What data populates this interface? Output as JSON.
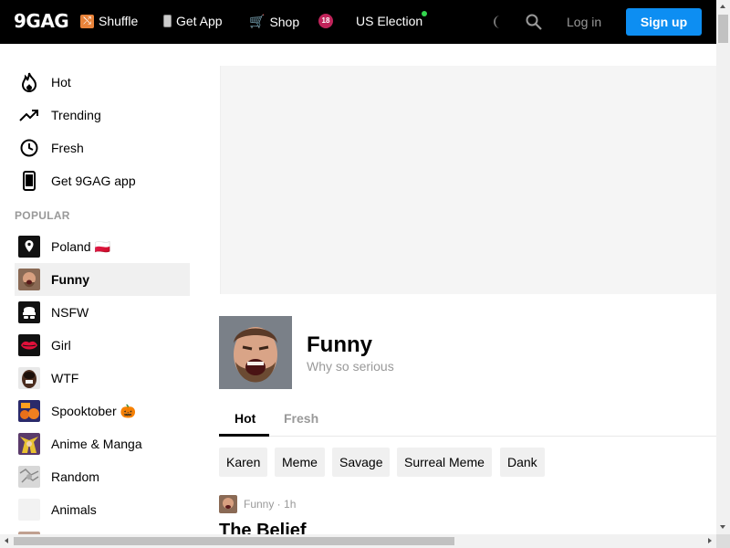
{
  "header": {
    "logo": "9GAG",
    "nav": [
      {
        "label": "Shuffle",
        "icon": "shuffle-icon"
      },
      {
        "label": "Get App",
        "icon": "phone-icon"
      },
      {
        "label": "Shop",
        "icon": "cart-icon"
      },
      {
        "label": "18",
        "icon": "nsfw-18-icon"
      },
      {
        "label": "US Election",
        "icon": "live-dot-icon"
      }
    ],
    "login_label": "Log in",
    "signup_label": "Sign up"
  },
  "sidebar": {
    "main_items": [
      {
        "label": "Hot",
        "icon": "fire-icon"
      },
      {
        "label": "Trending",
        "icon": "trending-icon"
      },
      {
        "label": "Fresh",
        "icon": "clock-icon"
      },
      {
        "label": "Get 9GAG app",
        "icon": "phone-icon"
      }
    ],
    "section_title": "POPULAR",
    "popular_items": [
      {
        "label": "Poland 🇵🇱",
        "icon": "location-icon"
      },
      {
        "label": "Funny",
        "icon": "funny-thumb",
        "active": true
      },
      {
        "label": "NSFW",
        "icon": "nsfw-icon"
      },
      {
        "label": "Girl",
        "icon": "lips-icon"
      },
      {
        "label": "WTF",
        "icon": "wtf-thumb"
      },
      {
        "label": "Spooktober 🎃",
        "icon": "spooktober-thumb"
      },
      {
        "label": "Anime & Manga",
        "icon": "anime-thumb"
      },
      {
        "label": "Random",
        "icon": "random-thumb"
      },
      {
        "label": "Animals",
        "icon": "animals-thumb"
      }
    ]
  },
  "section": {
    "title": "Funny",
    "description": "Why so serious",
    "tabs": [
      "Hot",
      "Fresh"
    ],
    "active_tab": "Hot",
    "tags": [
      "Karen",
      "Meme",
      "Savage",
      "Surreal Meme",
      "Dank"
    ]
  },
  "post": {
    "meta": "Funny · 1h",
    "title": "The Belief"
  },
  "colors": {
    "accent": "#0d8ef2",
    "header_bg": "#000000",
    "live_dot": "#33d64e"
  }
}
